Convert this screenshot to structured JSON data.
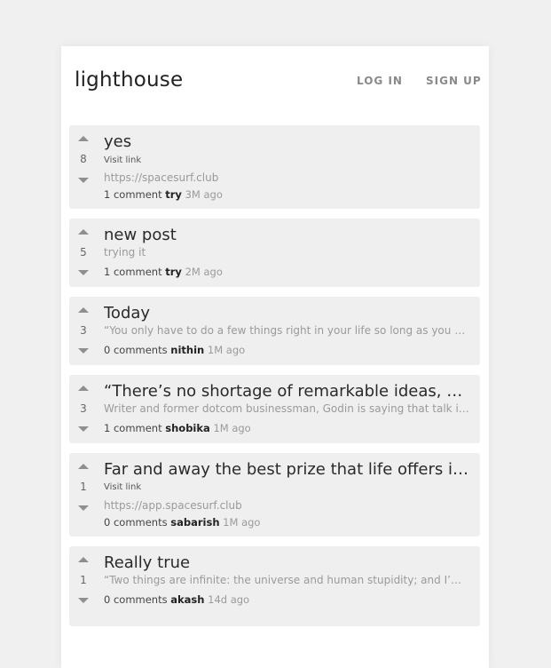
{
  "header": {
    "brand": "lighthouse",
    "login_label": "LOG IN",
    "signup_label": "SIGN UP"
  },
  "posts": [
    {
      "score": "8",
      "title": "yes",
      "visit_label": "Visit link",
      "desc": "https://spacesurf.club",
      "comments": "1 comment",
      "author": "try",
      "time": "3M ago"
    },
    {
      "score": "5",
      "title": "new post",
      "desc": "trying it",
      "comments": "1 comment",
      "author": "try",
      "time": "2M ago"
    },
    {
      "score": "3",
      "title": "Today",
      "desc": "“You only have to do a few things right in your life so long as you don’t do too many things wrong.” – Warren Buffett",
      "comments": "0 comments",
      "author": "nithin",
      "time": "1M ago"
    },
    {
      "score": "3",
      "title": "“There’s no shortage of remarkable ideas, what’s missing is the will to execute them.”",
      "desc": "Writer and former dotcom businessman, Godin is saying that talk is cheap and ideas are plentiful",
      "comments": "1 comment",
      "author": "shobika",
      "time": "1M ago"
    },
    {
      "score": "1",
      "title": "Far and away the best prize that life offers is the chance to work hard at work worth doing.",
      "visit_label": "Visit link",
      "desc": "https://app.spacesurf.club",
      "comments": "0 comments",
      "author": "sabarish",
      "time": "1M ago"
    },
    {
      "score": "1",
      "title": "Really true",
      "desc": "“Two things are infinite: the universe and human stupidity; and I’m not sure about the universe.”",
      "comments": "0 comments",
      "author": "akash",
      "time": "14d ago"
    }
  ]
}
